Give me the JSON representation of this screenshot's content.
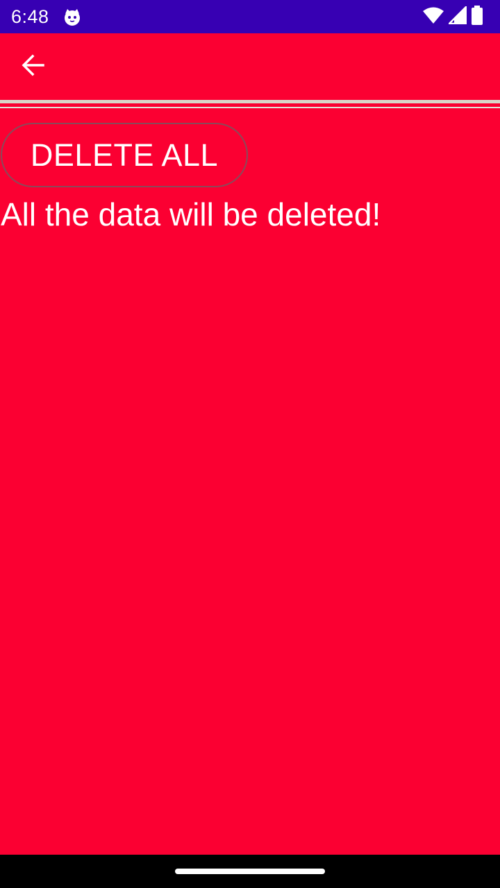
{
  "status_bar": {
    "time": "6:48",
    "app_icon": "cat-face-icon",
    "icons": [
      "wifi-icon",
      "cellular-signal-icon",
      "battery-icon"
    ],
    "background_color": "#3700b3"
  },
  "app_bar": {
    "back_icon": "arrow-back-icon"
  },
  "content": {
    "delete_all_label": "DELETE ALL",
    "warning_text": "All the data will be deleted!"
  },
  "theme": {
    "background_color": "#fb0032",
    "text_color": "#ffffff"
  }
}
